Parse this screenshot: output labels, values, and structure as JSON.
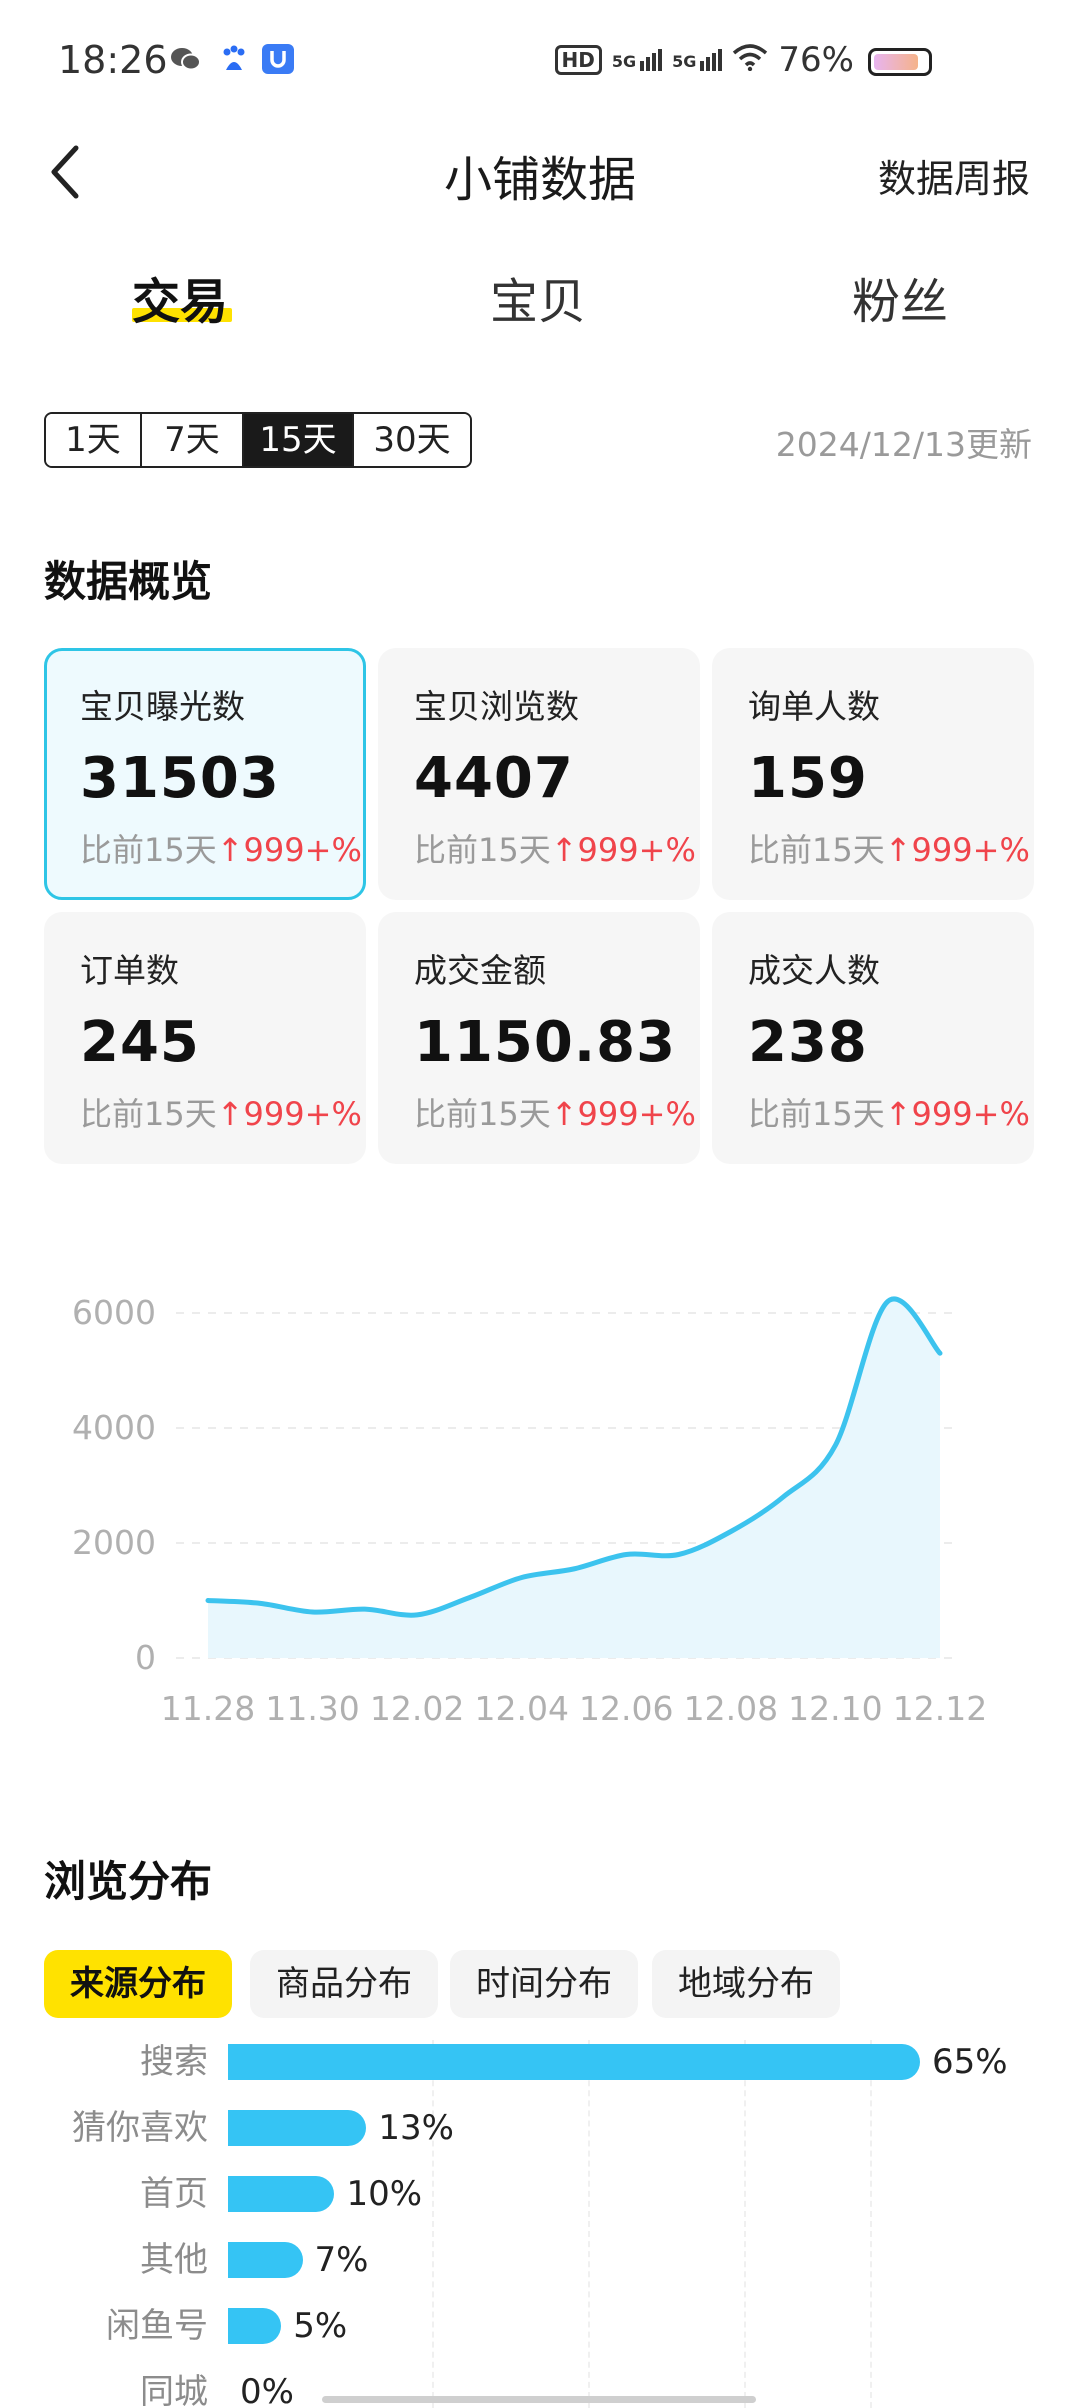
{
  "status_bar": {
    "time": "18:26",
    "hd_label": "HD",
    "signal_1": "5G",
    "signal_2": "5G",
    "battery_percent": "76%",
    "battery_level": 0.76,
    "icons": [
      "wechat-icon",
      "baidu-icon",
      "shield-app-icon",
      "wifi-icon",
      "signal-icon",
      "battery-icon"
    ]
  },
  "header": {
    "title": "小铺数据",
    "right_link": "数据周报",
    "back_icon": "chevron-left-icon"
  },
  "main_tabs": [
    {
      "label": "交易",
      "active": true
    },
    {
      "label": "宝贝",
      "active": false
    },
    {
      "label": "粉丝",
      "active": false
    }
  ],
  "range_options": [
    {
      "label": "1天",
      "active": false
    },
    {
      "label": "7天",
      "active": false
    },
    {
      "label": "15天",
      "active": true
    },
    {
      "label": "30天",
      "active": false
    }
  ],
  "update_text": "2024/12/13更新",
  "overview": {
    "heading": "数据概览",
    "cards": [
      {
        "label": "宝贝曝光数",
        "value": "31503",
        "compare": "比前15天",
        "delta": "↑999+%",
        "selected": true
      },
      {
        "label": "宝贝浏览数",
        "value": "4407",
        "compare": "比前15天",
        "delta": "↑999+%",
        "selected": false
      },
      {
        "label": "询单人数",
        "value": "159",
        "compare": "比前15天",
        "delta": "↑999+%",
        "selected": false
      },
      {
        "label": "订单数",
        "value": "245",
        "compare": "比前15天",
        "delta": "↑999+%",
        "selected": false
      },
      {
        "label": "成交金额",
        "value": "1150.83",
        "compare": "比前15天",
        "delta": "↑999+%",
        "selected": false
      },
      {
        "label": "成交人数",
        "value": "238",
        "compare": "比前15天",
        "delta": "↑999+%",
        "selected": false
      }
    ]
  },
  "chart_data": [
    {
      "type": "area",
      "x": [
        "11.28",
        "11.29",
        "11.30",
        "12.01",
        "12.02",
        "12.03",
        "12.04",
        "12.05",
        "12.06",
        "12.07",
        "12.08",
        "12.09",
        "12.10",
        "12.11",
        "12.12"
      ],
      "x_tick_labels": [
        "11.28",
        "11.30",
        "12.02",
        "12.04",
        "12.06",
        "12.08",
        "12.10",
        "12.12"
      ],
      "series": [
        {
          "values": [
            1000,
            950,
            800,
            850,
            750,
            1050,
            1400,
            1550,
            1800,
            1800,
            2200,
            2800,
            3700,
            6200,
            5300
          ]
        }
      ],
      "yticks": [
        0,
        2000,
        4000,
        6000
      ],
      "ylim": [
        0,
        6400
      ],
      "grid": true,
      "color": "#3cc3ee"
    },
    {
      "type": "bar",
      "orientation": "horizontal",
      "categories": [
        "搜索",
        "猜你喜欢",
        "首页",
        "其他",
        "闲鱼号",
        "同城"
      ],
      "values": [
        65,
        13,
        10,
        7,
        5,
        0
      ],
      "value_labels": [
        "65%",
        "13%",
        "10%",
        "7%",
        "5%",
        "0%"
      ],
      "color": "#35c4f4"
    }
  ],
  "browse": {
    "heading": "浏览分布",
    "filter_tabs": [
      {
        "label": "来源分布",
        "active": true
      },
      {
        "label": "商品分布",
        "active": false
      },
      {
        "label": "时间分布",
        "active": false
      },
      {
        "label": "地域分布",
        "active": false
      }
    ]
  }
}
